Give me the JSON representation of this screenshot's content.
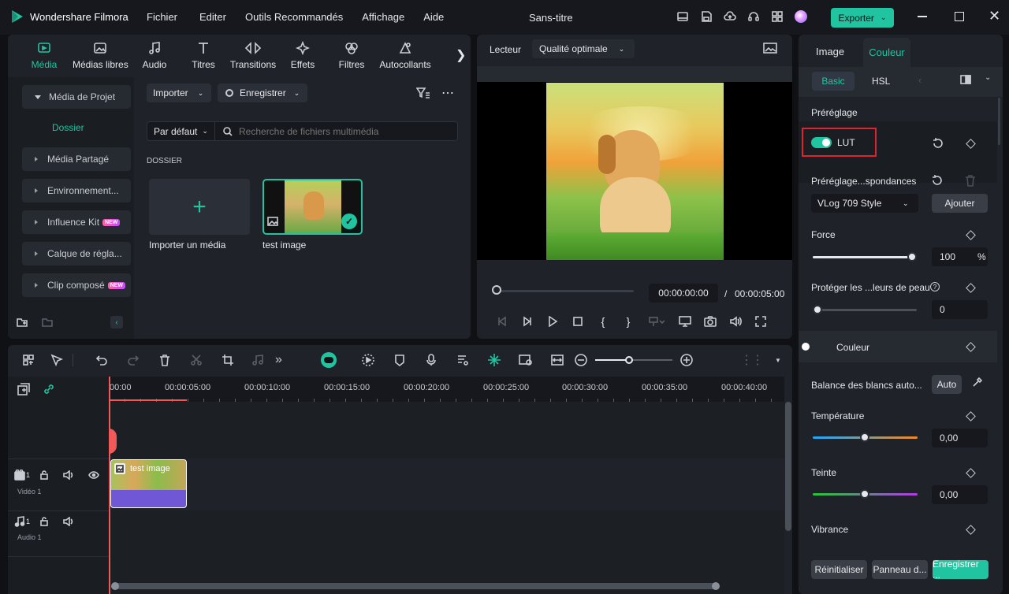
{
  "app": {
    "name": "Wondershare Filmora",
    "doc_title": "Sans-titre",
    "export_label": "Exporter",
    "menu": [
      "Fichier",
      "Editer",
      "Outils Recommandés",
      "Affichage",
      "Aide"
    ]
  },
  "media_tabs": [
    {
      "label": "Média",
      "icon": "media-icon",
      "active": true
    },
    {
      "label": "Médias libres",
      "icon": "stock-media-icon"
    },
    {
      "label": "Audio",
      "icon": "music-note-icon"
    },
    {
      "label": "Titres",
      "icon": "text-t-icon"
    },
    {
      "label": "Transitions",
      "icon": "transitions-icon"
    },
    {
      "label": "Effets",
      "icon": "effects-icon"
    },
    {
      "label": "Filtres",
      "icon": "filters-icon"
    },
    {
      "label": "Autocollants",
      "icon": "stickers-icon"
    }
  ],
  "sidebar": {
    "project_media": "Média de Projet",
    "folder": "Dossier",
    "items": [
      {
        "label": "Média Partagé",
        "new": false
      },
      {
        "label": "Environnement...",
        "new": false
      },
      {
        "label": "Influence Kit",
        "new": true
      },
      {
        "label": "Calque de régla...",
        "new": false
      },
      {
        "label": "Clip composé",
        "new": true
      }
    ],
    "new_badge": "NEW"
  },
  "library": {
    "import": "Importer",
    "record": "Enregistrer",
    "sort": "Par défaut",
    "search_placeholder": "Recherche de fichiers multimédia",
    "section": "DOSSIER",
    "import_tile": "Importer un média",
    "item_name": "test image"
  },
  "player": {
    "label": "Lecteur",
    "quality": "Qualité optimale",
    "current": "00:00:00:00",
    "separator": "/",
    "total": "00:00:05:00"
  },
  "right": {
    "tabs": [
      "Image",
      "Couleur"
    ],
    "subtabs": [
      "Basic",
      "HSL"
    ],
    "preset_title": "Préréglage",
    "lut": "LUT",
    "preset_corr": "Préréglage...spondances",
    "preset_value": "VLog 709 Style",
    "add": "Ajouter",
    "force": "Force",
    "force_value": "100",
    "percent": "%",
    "protect": "Protéger les ...leurs de peau",
    "protect_value": "0",
    "color": "Couleur",
    "wb": "Balance des blancs auto...",
    "auto": "Auto",
    "temp": "Température",
    "temp_value": "0,00",
    "tint": "Teinte",
    "tint_value": "0,00",
    "vibrance": "Vibrance",
    "reset": "Réinitialiser",
    "panel": "Panneau d...",
    "save": "Enregistrer ..."
  },
  "timeline": {
    "ticks": [
      "00:00",
      "00:00:05:00",
      "00:00:10:00",
      "00:00:15:00",
      "00:00:20:00",
      "00:00:25:00",
      "00:00:30:00",
      "00:00:35:00",
      "00:00:40:00"
    ],
    "video_track": "Vidéo 1",
    "audio_track": "Audio 1",
    "track_num": "1",
    "clip_name": "test image"
  },
  "colors": {
    "accent": "#21c4a0",
    "highlight_box": "#e0242f",
    "clip_purple": "#6f57d6",
    "playhead": "#f25a5a"
  }
}
